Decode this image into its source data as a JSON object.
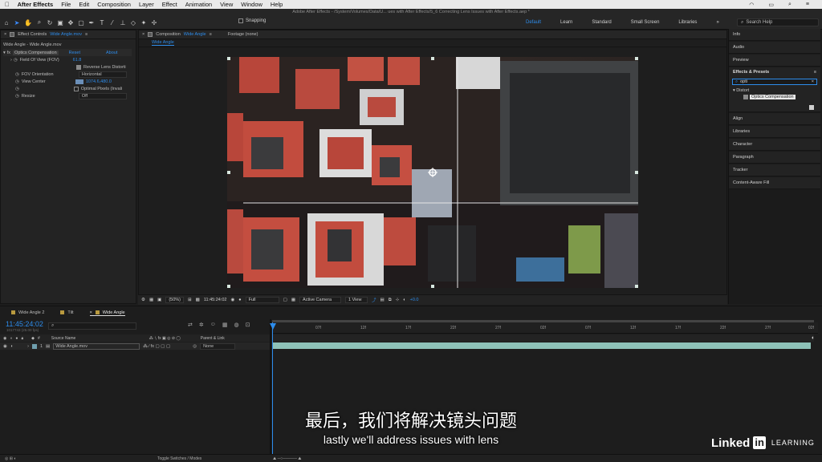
{
  "menubar": {
    "app_name": "After Effects",
    "items": [
      "File",
      "Edit",
      "Composition",
      "Layer",
      "Effect",
      "Animation",
      "View",
      "Window",
      "Help"
    ]
  },
  "window": {
    "title": "Adobe After Effects - /System/Volumes/Data/U... ues with After Effects/5_6 Correcting Lens Issues with After Effects.aep *"
  },
  "toolbar": {
    "snapping_label": "Snapping",
    "workspaces": [
      "Default",
      "Learn",
      "Standard",
      "Small Screen",
      "Libraries"
    ],
    "active_workspace": "Default",
    "search_help_placeholder": "Search Help"
  },
  "effect_controls": {
    "tab_label": "Effect Controls",
    "tab_layer": "Wide Angle.mov",
    "header": "Wide Angle - Wide Angle.mov",
    "effect_name": "Optics Compensation",
    "reset_label": "Reset",
    "about_label": "About",
    "fov_label": "Field Of View (FOV)",
    "fov_value": "61.8",
    "reverse_label": "Reverse Lens Distorti",
    "fov_orientation_label": "FOV Orientation",
    "fov_orientation_value": "Horizontal",
    "view_center_label": "View Center",
    "view_center_value": "1074.6,480.0",
    "optimal_pixels_label": "Optimal Pixels (Invali",
    "resize_label": "Resize",
    "resize_value": "Off"
  },
  "composition": {
    "tab_label": "Composition",
    "tab_name": "Wide Angle",
    "footage_tab": "Footage (none)",
    "sub_tab": "Wide Angle"
  },
  "viewer_controls": {
    "zoom": "(50%)",
    "timecode": "11:45:24:02",
    "resolution": "Full",
    "camera": "Active Camera",
    "views": "1 View",
    "exposure": "+0.0"
  },
  "right_panel": {
    "items": [
      "Info",
      "Audio",
      "Preview"
    ],
    "effects_presets_title": "Effects & Presets",
    "search_value": "opti",
    "category": "Distort",
    "result": "Optics Compensation",
    "lower_items": [
      "Align",
      "Libraries",
      "Character",
      "Paragraph",
      "Tracker",
      "Content-Aware Fill"
    ]
  },
  "timeline": {
    "tabs": [
      "Wide Angle 2",
      "Tilt",
      "Wide Angle"
    ],
    "current_time": "11:45:24:02",
    "frame_info": "1017743 (25.00 fps)",
    "columns": {
      "source_name": "Source Name",
      "parent_link": "Parent & Link"
    },
    "layer": {
      "number": "1",
      "name": "Wide Angle.mov",
      "parent": "None"
    },
    "ruler_labels": [
      "07f",
      "12f",
      "17f",
      "22f",
      "27f",
      "02f",
      "07f",
      "12f",
      "17f",
      "22f",
      "27f",
      "02f"
    ],
    "toggle_label": "Toggle Switches / Modes"
  },
  "subtitles": {
    "chinese": "最后，我们将解决镜头问题",
    "english": "lastly we'll address issues with lens"
  },
  "branding": {
    "linked": "Linked",
    "in": "in",
    "learning": "LEARNING"
  },
  "colors": {
    "accent": "#2d8ceb",
    "panel": "#232323",
    "layer_bar": "#8ec2b8"
  }
}
